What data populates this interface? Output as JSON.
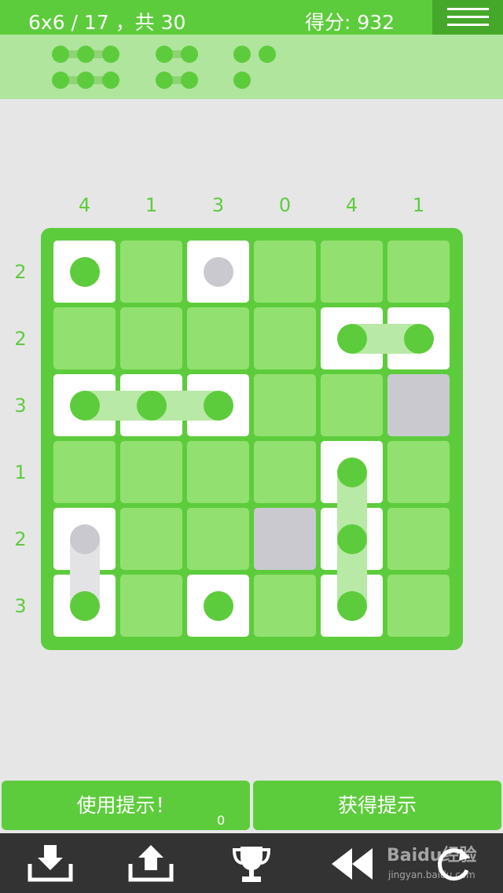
{
  "header": {
    "level_progress": "6x6 / 17 ，共 30",
    "score": "得分: 932"
  },
  "ship_legend": [
    {
      "size": 3,
      "count": 2
    },
    {
      "size": 2,
      "count": 2
    },
    {
      "size": 1,
      "count": 3
    }
  ],
  "puzzle": {
    "size": 6,
    "column_clues": [
      "4",
      "1",
      "3",
      "0",
      "4",
      "1"
    ],
    "row_clues": [
      "2",
      "2",
      "3",
      "1",
      "2",
      "3"
    ],
    "cells": [
      [
        "peg",
        "empty",
        "peg-gray",
        "empty",
        "empty",
        "empty"
      ],
      [
        "empty",
        "empty",
        "empty",
        "empty",
        "peg",
        "peg"
      ],
      [
        "peg",
        "peg",
        "peg",
        "empty",
        "empty",
        "blocked"
      ],
      [
        "empty",
        "empty",
        "empty",
        "empty",
        "peg",
        "empty"
      ],
      [
        "peg-gray",
        "empty",
        "empty",
        "blocked",
        "peg",
        "empty"
      ],
      [
        "peg",
        "empty",
        "peg",
        "empty",
        "peg",
        "empty"
      ]
    ],
    "ships": [
      {
        "cells": [
          [
            0,
            0
          ]
        ]
      },
      {
        "cells": [
          [
            0,
            2
          ]
        ],
        "gray": true
      },
      {
        "cells": [
          [
            1,
            4
          ],
          [
            1,
            5
          ]
        ]
      },
      {
        "cells": [
          [
            2,
            0
          ],
          [
            2,
            1
          ],
          [
            2,
            2
          ]
        ]
      },
      {
        "cells": [
          [
            3,
            4
          ],
          [
            4,
            4
          ],
          [
            5,
            4
          ]
        ]
      },
      {
        "cells": [
          [
            4,
            0
          ],
          [
            5,
            0
          ]
        ],
        "gray": true
      },
      {
        "cells": [
          [
            5,
            2
          ]
        ]
      }
    ]
  },
  "buttons": {
    "use_hint": "使用提示！",
    "hint_count": "0",
    "get_hint": "获得提示"
  },
  "toolbar": {
    "icons": [
      "download-icon",
      "upload-icon",
      "trophy-icon",
      "rewind-icon",
      "refresh-icon"
    ]
  },
  "watermark": {
    "logo_text": "Baidu经验",
    "url": "jingyan.baidu.com"
  },
  "colors": {
    "accent": "#5dcc3c",
    "cell": "#92e170",
    "filled": "#ffffff",
    "blocked": "#c9c9cf",
    "toolbar": "#333333"
  }
}
